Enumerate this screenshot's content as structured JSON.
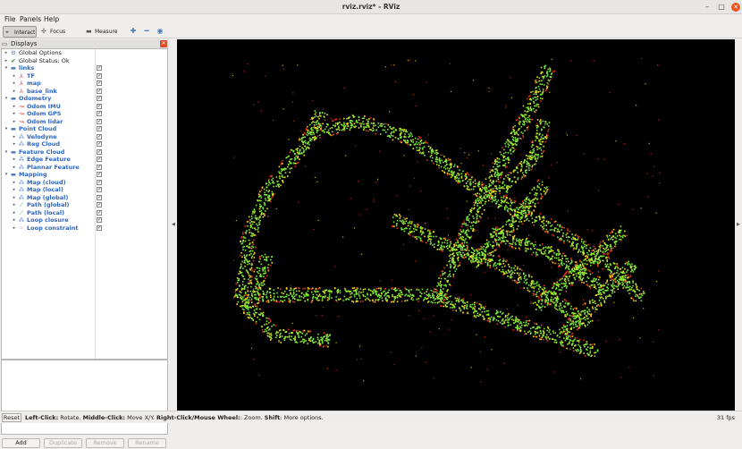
{
  "window": {
    "title": "rviz.rviz* - RViz"
  },
  "menubar": {
    "items": [
      "File",
      "Panels",
      "Help"
    ]
  },
  "toolbar": {
    "interact": "Interact",
    "focus_camera": "Focus Camera",
    "measure": "Measure",
    "icons": [
      "2d-pose-icon",
      "2d-nav-goal-icon",
      "publish-point-icon"
    ]
  },
  "displays": {
    "title": "Displays",
    "rows": [
      {
        "label": "Global Options",
        "icon": "gear",
        "level": 0,
        "group": false,
        "checked": null
      },
      {
        "label": "Global Status: Ok",
        "icon": "check",
        "level": 0,
        "group": false,
        "checked": null
      },
      {
        "label": "links",
        "icon": "folder",
        "level": 0,
        "group": true,
        "checked": true
      },
      {
        "label": "TF",
        "icon": "tf",
        "level": 1,
        "group": false,
        "checked": true
      },
      {
        "label": "map",
        "icon": "axes",
        "level": 1,
        "group": false,
        "checked": true
      },
      {
        "label": "base_link",
        "icon": "axes",
        "level": 1,
        "group": false,
        "checked": true
      },
      {
        "label": "Odometry",
        "icon": "folder",
        "level": 0,
        "group": true,
        "checked": true
      },
      {
        "label": "Odom IMU",
        "icon": "odom",
        "level": 1,
        "group": false,
        "checked": true
      },
      {
        "label": "Odom GPS",
        "icon": "odom",
        "level": 1,
        "group": false,
        "checked": true
      },
      {
        "label": "Odom lidar",
        "icon": "odom",
        "level": 1,
        "group": false,
        "checked": true
      },
      {
        "label": "Point Cloud",
        "icon": "folder",
        "level": 0,
        "group": true,
        "checked": true
      },
      {
        "label": "Velodyne",
        "icon": "cloud",
        "level": 1,
        "group": false,
        "checked": true
      },
      {
        "label": "Reg Cloud",
        "icon": "cloud",
        "level": 1,
        "group": false,
        "checked": true
      },
      {
        "label": "Feature Cloud",
        "icon": "folder",
        "level": 0,
        "group": true,
        "checked": true
      },
      {
        "label": "Edge Feature",
        "icon": "cloud",
        "level": 1,
        "group": false,
        "checked": true
      },
      {
        "label": "Plannar Feature",
        "icon": "cloud",
        "level": 1,
        "group": false,
        "checked": true
      },
      {
        "label": "Mapping",
        "icon": "folder",
        "level": 0,
        "group": true,
        "checked": true
      },
      {
        "label": "Map (cloud)",
        "icon": "cloud",
        "level": 1,
        "group": false,
        "checked": true
      },
      {
        "label": "Map (local)",
        "icon": "cloud",
        "level": 1,
        "group": false,
        "checked": true
      },
      {
        "label": "Map (global)",
        "icon": "cloud",
        "level": 1,
        "group": false,
        "checked": true
      },
      {
        "label": "Path (global)",
        "icon": "path",
        "level": 1,
        "group": false,
        "checked": true
      },
      {
        "label": "Path (local)",
        "icon": "path",
        "level": 1,
        "group": false,
        "checked": true
      },
      {
        "label": "Loop closure",
        "icon": "cloud",
        "level": 1,
        "group": false,
        "checked": true
      },
      {
        "label": "Loop constraint",
        "icon": "marker",
        "level": 1,
        "group": false,
        "checked": true
      }
    ],
    "buttons": {
      "add": "Add",
      "duplicate": "Duplicate",
      "remove": "Remove",
      "rename": "Rename"
    }
  },
  "statusbar": {
    "reset": "Reset",
    "hint": [
      {
        "text": "Left-Click:",
        "bold": true
      },
      {
        "text": " Rotate. ",
        "bold": false
      },
      {
        "text": "Middle-Click:",
        "bold": true
      },
      {
        "text": " Move X/Y. ",
        "bold": false
      },
      {
        "text": "Right-Click/Mouse Wheel:",
        "bold": true
      },
      {
        "text": ": Zoom. ",
        "bold": false
      },
      {
        "text": "Shift",
        "bold": true
      },
      {
        "text": ": More options.",
        "bold": false
      }
    ],
    "fps": "31 fps"
  },
  "colors": {
    "background": "#000000",
    "cloud_primary": "#7de83a",
    "cloud_secondary": "#f0e020",
    "cloud_edge": "#e0301e"
  }
}
